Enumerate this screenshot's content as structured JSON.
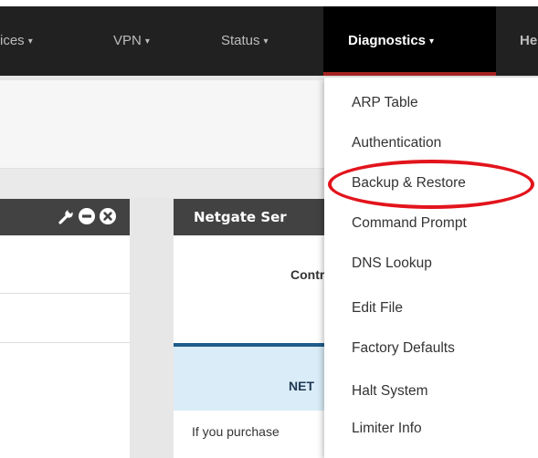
{
  "navbar": {
    "items": [
      {
        "label": "ices",
        "caret": "▾"
      },
      {
        "label": "VPN",
        "caret": "▾"
      },
      {
        "label": "Status",
        "caret": "▾"
      },
      {
        "label": "Diagnostics",
        "caret": "▾"
      },
      {
        "label": "He",
        "caret": ""
      }
    ],
    "active_item": "Diagnostics"
  },
  "left_panel": {
    "header_icons": [
      "wrench-icon",
      "minus-circle-icon",
      "close-circle-icon"
    ]
  },
  "right_panel": {
    "title": "Netgate Ser",
    "contract_text": "Contr",
    "net_text": "NET",
    "body_text": "If you purchase"
  },
  "diagnostics_menu": {
    "items": [
      "ARP Table",
      "Authentication",
      "Backup & Restore",
      "Command Prompt",
      "DNS Lookup",
      "Edit File",
      "Factory Defaults",
      "Halt System",
      "Limiter Info"
    ],
    "highlighted_item": "Backup & Restore"
  },
  "colors": {
    "navbar_bg": "#212121",
    "active_bg": "#000000",
    "active_underline": "#a72323",
    "panel_header_bg": "#424242",
    "annotation_red": "#e2141c",
    "info_band": "#d9ecf7"
  }
}
